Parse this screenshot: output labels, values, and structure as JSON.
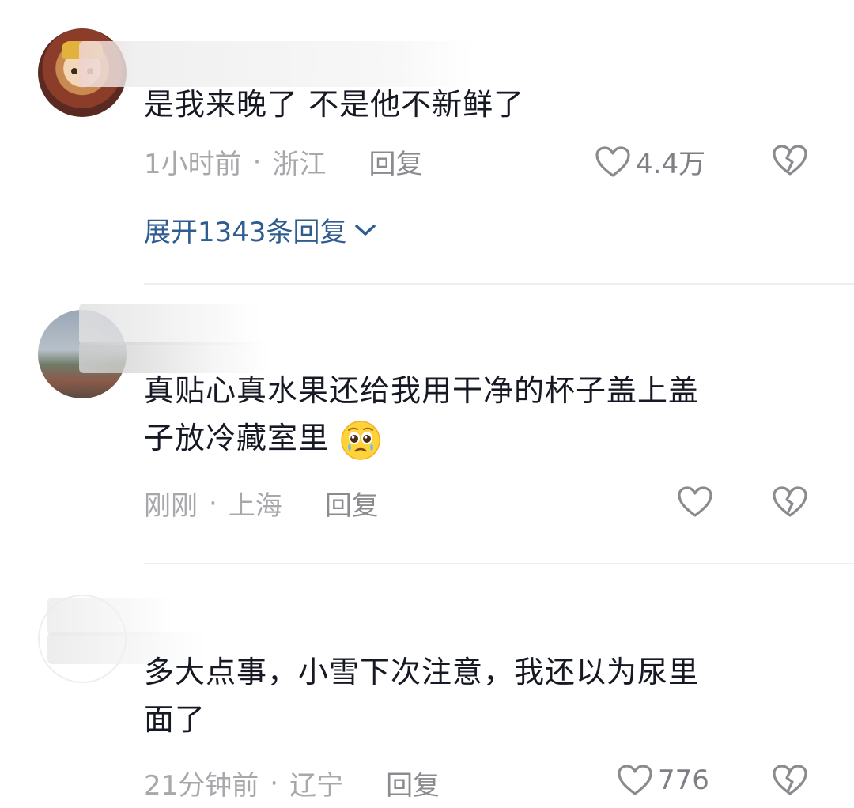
{
  "comments": [
    {
      "text": "是我来晚了 不是他不新鲜了",
      "time": "1小时前",
      "location": "浙江",
      "reply_label": "回复",
      "likes": "4.4万",
      "expand_label": "展开1343条回复"
    },
    {
      "text_line1": "真贴心真水果还给我用干净的杯子盖上盖",
      "text_line2": "子放冷藏室里",
      "emoji": "pleading-face-emoji",
      "time": "刚刚",
      "location": "上海",
      "reply_label": "回复",
      "likes": ""
    },
    {
      "text_line1": "多大点事，小雪下次注意，我还以为尿里",
      "text_line2": "面了",
      "time": "21分钟前",
      "location": "辽宁",
      "reply_label": "回复",
      "likes": "776"
    }
  ],
  "icons": {
    "like": "heart-outline-icon",
    "dislike": "broken-heart-icon",
    "expand": "chevron-down-icon"
  },
  "colors": {
    "text": "#161823",
    "meta": "#a7a8ab",
    "link": "#2f5d91"
  }
}
